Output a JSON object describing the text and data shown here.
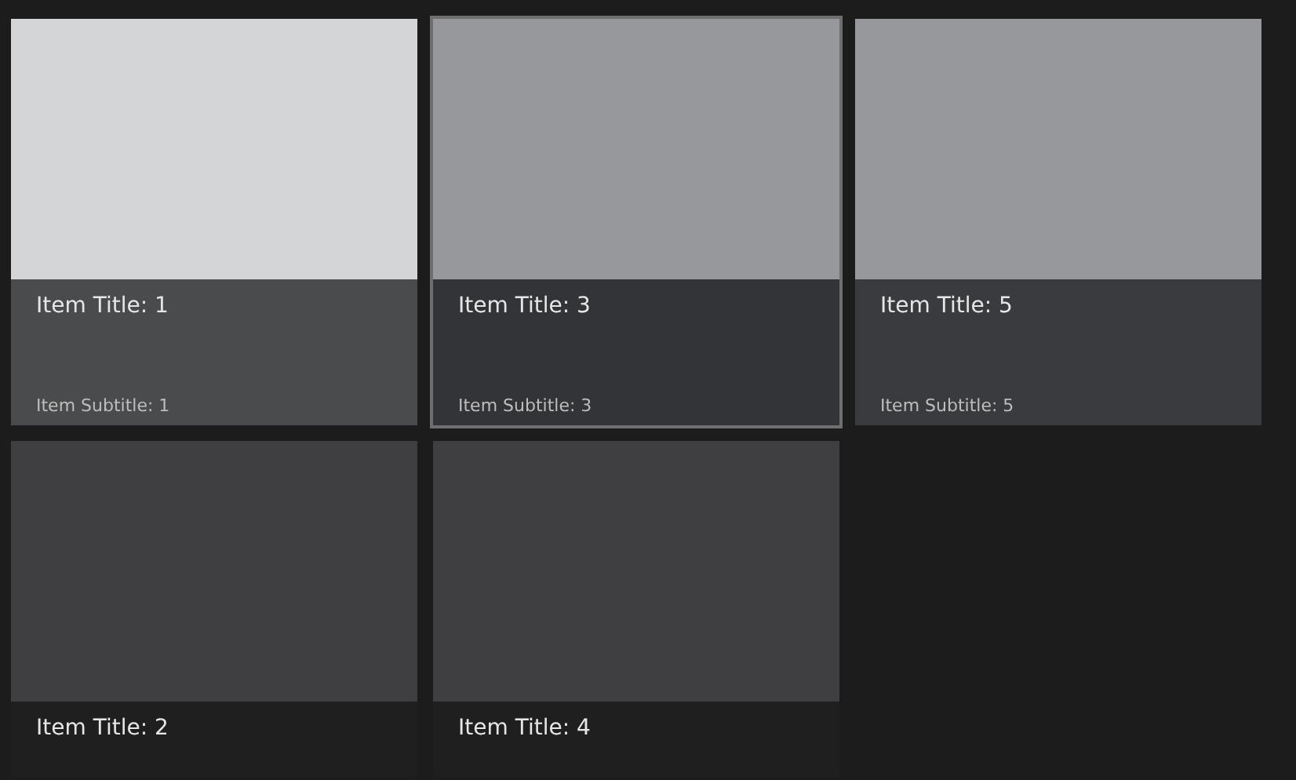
{
  "items": [
    {
      "title": "Item Title: 1",
      "subtitle": "Item Subtitle: 1",
      "hovered": true,
      "selected": false,
      "dimmed": false
    },
    {
      "title": "Item Title: 2",
      "hovered": false,
      "selected": false,
      "dimmed": true
    },
    {
      "title": "Item Title: 3",
      "subtitle": "Item Subtitle: 3",
      "hovered": false,
      "selected": true,
      "dimmed": false
    },
    {
      "title": "Item Title: 4",
      "hovered": false,
      "selected": false,
      "dimmed": true
    },
    {
      "title": "Item Title: 5",
      "subtitle": "Item Subtitle: 5",
      "hovered": false,
      "selected": false,
      "dimmed": false
    }
  ]
}
